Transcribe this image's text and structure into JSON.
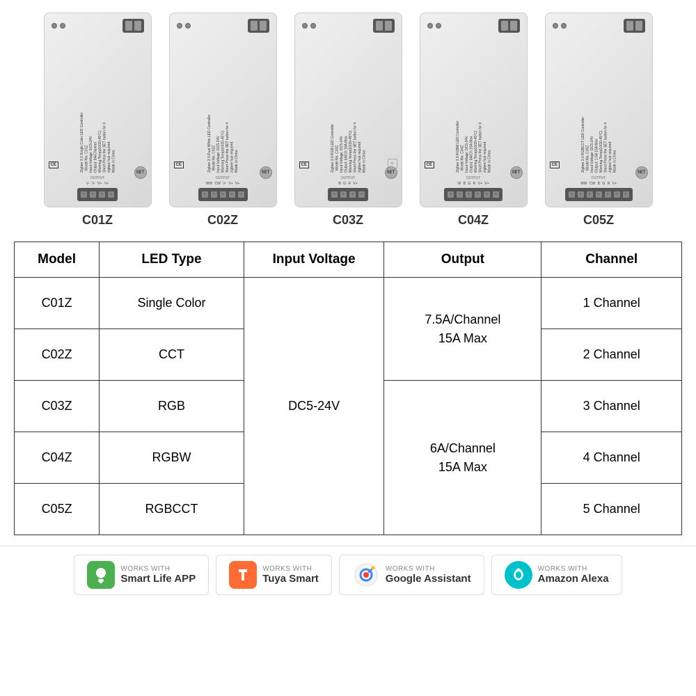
{
  "products": [
    {
      "id": "c01z",
      "model": "C01Z",
      "terminals_bottom": 4,
      "color": "#e8e8e8",
      "label_output": [
        "V-",
        "V-",
        "V+",
        "V+"
      ]
    },
    {
      "id": "c02z",
      "model": "C02Z",
      "terminals_bottom": 5,
      "color": "#e8e8e8",
      "label_output": [
        "WW",
        "CW",
        "V-",
        "V+",
        "V+"
      ]
    },
    {
      "id": "c03z",
      "model": "C03Z",
      "terminals_bottom": 5,
      "color": "#e8e8e8",
      "label_output": [
        "B",
        "G",
        "R",
        "V+",
        ""
      ]
    },
    {
      "id": "c04z",
      "model": "C04Z",
      "terminals_bottom": 6,
      "color": "#e8e8e8",
      "label_output": [
        "W",
        "B",
        "G",
        "R",
        "V+",
        "V+"
      ]
    },
    {
      "id": "c05z",
      "model": "C05Z",
      "terminals_bottom": 7,
      "color": "#e8e8e8",
      "label_output": [
        "WW",
        "CW",
        "W",
        "B",
        "G",
        "R",
        "V+"
      ]
    }
  ],
  "table": {
    "headers": [
      "Model",
      "LED Type",
      "Input Voltage",
      "Output",
      "Channel"
    ],
    "rows": [
      {
        "model": "C01Z",
        "led_type": "Single Color",
        "voltage": "DC5-24V",
        "output": "7.5A/Channel\n15A Max",
        "channel": "1 Channel"
      },
      {
        "model": "C02Z",
        "led_type": "CCT",
        "voltage": "",
        "output": "",
        "channel": "2 Channel"
      },
      {
        "model": "C03Z",
        "led_type": "RGB",
        "voltage": "",
        "output": "6A/Channel\n15A Max",
        "channel": "3 Channel"
      },
      {
        "model": "C04Z",
        "led_type": "RGBW",
        "voltage": "",
        "output": "",
        "channel": "4 Channel"
      },
      {
        "model": "C05Z",
        "led_type": "RGBCCT",
        "voltage": "",
        "output": "",
        "channel": "5 Channel"
      }
    ],
    "voltage_value": "DC5-24V",
    "output_top": "7.5A/Channel",
    "output_top2": "15A Max",
    "output_bottom": "6A/Channel",
    "output_bottom2": "15A Max"
  },
  "badges": [
    {
      "id": "smart-life",
      "works_with": "WORKS WITH",
      "name": "Smart  Life APP",
      "icon_type": "smart-life"
    },
    {
      "id": "tuya",
      "works_with": "WORKS WITH",
      "name": "Tuya Smart",
      "icon_type": "tuya"
    },
    {
      "id": "google",
      "works_with": "WORKS WITH",
      "name": "Google Assistant",
      "icon_type": "google"
    },
    {
      "id": "alexa",
      "works_with": "WORKS WITH",
      "name": "Amazon Alexa",
      "icon_type": "alexa"
    }
  ]
}
